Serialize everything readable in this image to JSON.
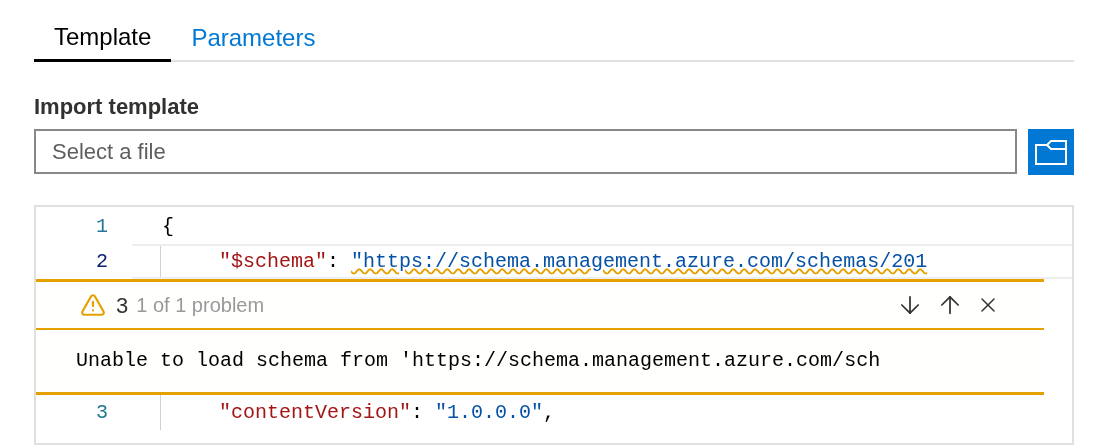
{
  "tabs": [
    {
      "label": "Template",
      "selected": true
    },
    {
      "label": "Parameters",
      "selected": false
    }
  ],
  "import": {
    "label": "Import template",
    "placeholder": "Select a file"
  },
  "editor": {
    "lines_before": [
      {
        "number": "1",
        "current": false,
        "tokens": [
          {
            "kind": "punct",
            "text": "{"
          }
        ]
      },
      {
        "number": "2",
        "current": true,
        "tokens": [
          {
            "kind": "key",
            "text": "\"$schema\""
          },
          {
            "kind": "punct",
            "text": ": "
          },
          {
            "kind": "string",
            "text": "\"https://schema.management.azure.com/schemas/201",
            "squiggle": true
          }
        ]
      }
    ],
    "problem": {
      "count": "3",
      "summary": "1 of 1 problem",
      "message": "Unable to load schema from 'https://schema.management.azure.com/sch"
    },
    "lines_after": [
      {
        "number": "3",
        "current": false,
        "tokens": [
          {
            "kind": "key",
            "text": "\"contentVersion\""
          },
          {
            "kind": "punct",
            "text": ": "
          },
          {
            "kind": "string",
            "text": "\"1.0.0.0\""
          },
          {
            "kind": "punct",
            "text": ","
          }
        ]
      }
    ]
  }
}
